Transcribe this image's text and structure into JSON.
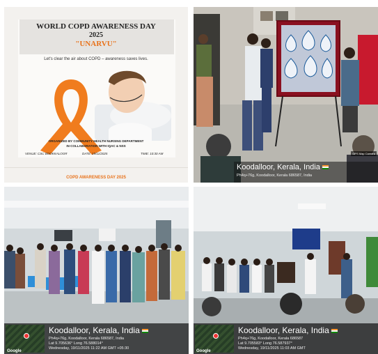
{
  "poster": {
    "title_line1": "WORLD COPD AWARENESS DAY",
    "title_line2": "2025",
    "title_line3": "\"UNARVU\"",
    "tagline": "Let's clear the air about COPD – awareness saves lives.",
    "organizer_line1": "ORGANIZED BY COMMUNITY HEALTH NURSING DEPARTMENT",
    "organizer_line2": "IN COLLABORATION WITH IQAC & NSS",
    "venue": "VENUE: CSC BOOKKALOOR",
    "date": "DATE: 19/11/2025",
    "time": "TIME: 10:30 AM",
    "footer": "COPD AWARENESS DAY 2025",
    "ribbon_color": "#f07c1e",
    "title_accent_color": "#e8731c"
  },
  "photo_top_right": {
    "location": "Koodalloor, Kerala, India",
    "address": "Ph4q+76g, Koodalloor, Kerala 686587, India",
    "badge": "GPS Map Camera"
  },
  "photo_bottom_left": {
    "location": "Koodalloor, Kerala, India",
    "address": "Ph4q+76g, Koodalloor, Kerala 686587, India",
    "coordinates": "Lat 9.705636° Long 76.588014°",
    "timestamp": "Wednesday, 19/11/2025 11:22 AM GMT +05:30",
    "map_label": "Google"
  },
  "photo_bottom_right": {
    "location": "Koodalloor, Kerala, India",
    "address": "Ph4q+76g, Koodalloor, Kerala 686587",
    "coordinates": "Lat 9.705583° Long 76.587937°",
    "timestamp": "Wednesday, 19/11/2025 11:03 AM GMT",
    "map_label": "Google"
  }
}
